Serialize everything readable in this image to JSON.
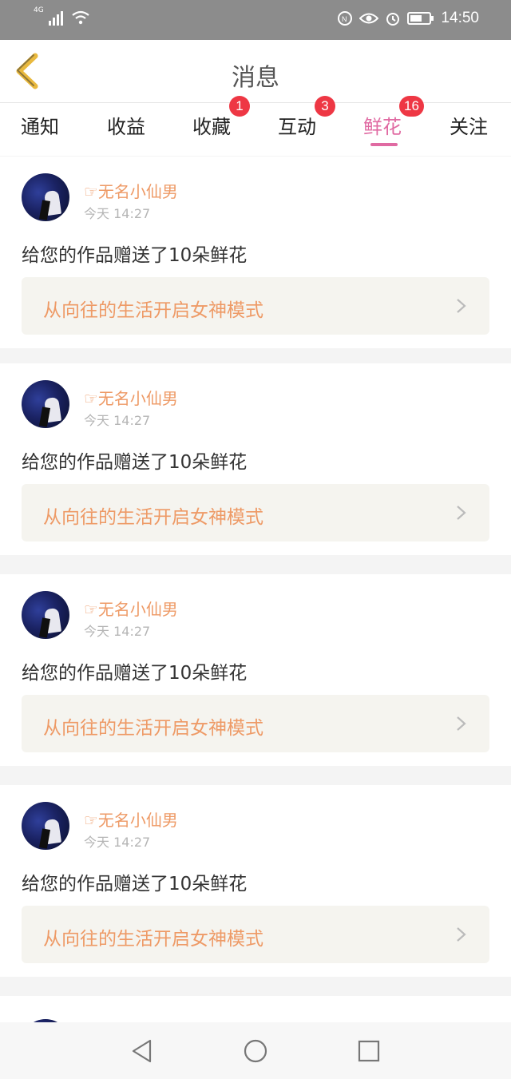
{
  "status_bar": {
    "network": "4G",
    "time": "14:50"
  },
  "header": {
    "title": "消息",
    "back_icon": "chevron-left-icon"
  },
  "tabs": [
    {
      "label": "通知",
      "badge": ""
    },
    {
      "label": "收益",
      "badge": ""
    },
    {
      "label": "收藏",
      "badge": "1"
    },
    {
      "label": "互动",
      "badge": "3"
    },
    {
      "label": "鲜花",
      "badge": "16",
      "active": true
    },
    {
      "label": "关注",
      "badge": ""
    }
  ],
  "notifications": [
    {
      "username": "☞无名小仙男",
      "time": "今天 14:27",
      "message": "给您的作品赠送了10朵鲜花",
      "work_title": "从向往的生活开启女神模式"
    },
    {
      "username": "☞无名小仙男",
      "time": "今天 14:27",
      "message": "给您的作品赠送了10朵鲜花",
      "work_title": "从向往的生活开启女神模式"
    },
    {
      "username": "☞无名小仙男",
      "time": "今天 14:27",
      "message": "给您的作品赠送了10朵鲜花",
      "work_title": "从向往的生活开启女神模式"
    },
    {
      "username": "☞无名小仙男",
      "time": "今天 14:27",
      "message": "给您的作品赠送了10朵鲜花",
      "work_title": "从向往的生活开启女神模式"
    }
  ],
  "colors": {
    "accent_pink": "#e06aa2",
    "orange_text": "#ee9a66",
    "badge_red": "#ee3744"
  }
}
